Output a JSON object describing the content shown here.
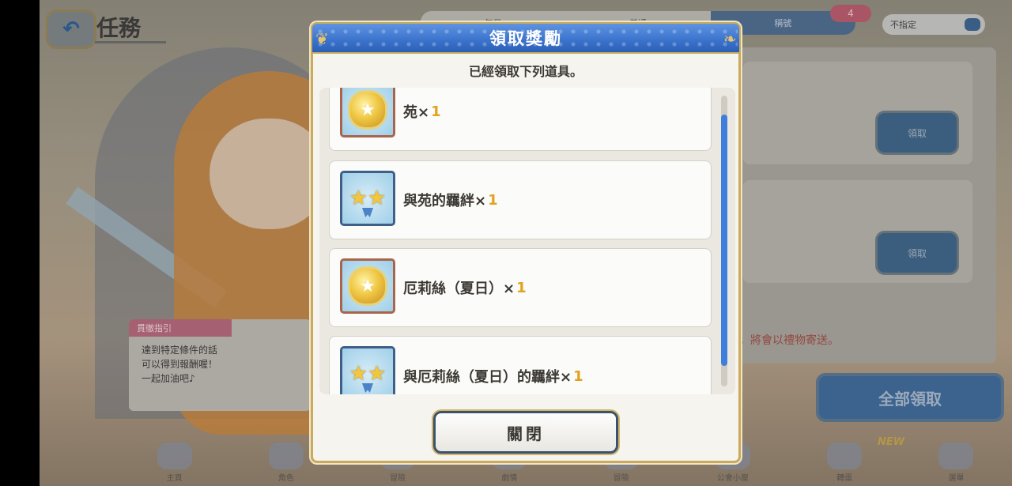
{
  "background": {
    "page_title": "任務",
    "top_tabs": [
      "每日",
      "普通",
      "稱號"
    ],
    "tab_badge": "4",
    "filter_select": "不指定",
    "claim_label": "領取",
    "notice": "，將會以禮物寄送。",
    "claim_all_label": "全部領取",
    "speech_title": "貫徹指引",
    "speech_lines": [
      "達到特定條件的話",
      "可以得到報酬喔！",
      "一起加油吧♪"
    ],
    "bottom_nav": [
      "主頁",
      "角色",
      "冒險",
      "劇情",
      "冒險",
      "公會小屋",
      "轉蛋",
      "選單"
    ],
    "new_tag": "NEW"
  },
  "modal": {
    "title": "領取獎勵",
    "subtitle": "已經領取下列道具。",
    "items": [
      {
        "name": "苑×",
        "qty": "1",
        "icon": "gold-medal-icon"
      },
      {
        "name": "與苑的羈絆×",
        "qty": "1",
        "icon": "bond-stars-icon"
      },
      {
        "name": "厄莉絲（夏日）×",
        "qty": "1",
        "icon": "gold-medal-icon"
      },
      {
        "name": "與厄莉絲（夏日）的羈絆×",
        "qty": "1",
        "icon": "bond-stars-icon"
      }
    ],
    "close_label": "關閉"
  },
  "colors": {
    "header_blue": "#3a72cc",
    "frame_gold": "#c9aa5e",
    "quantity_orange": "#e1a21e",
    "scroll_blue": "#3f7fdb"
  }
}
